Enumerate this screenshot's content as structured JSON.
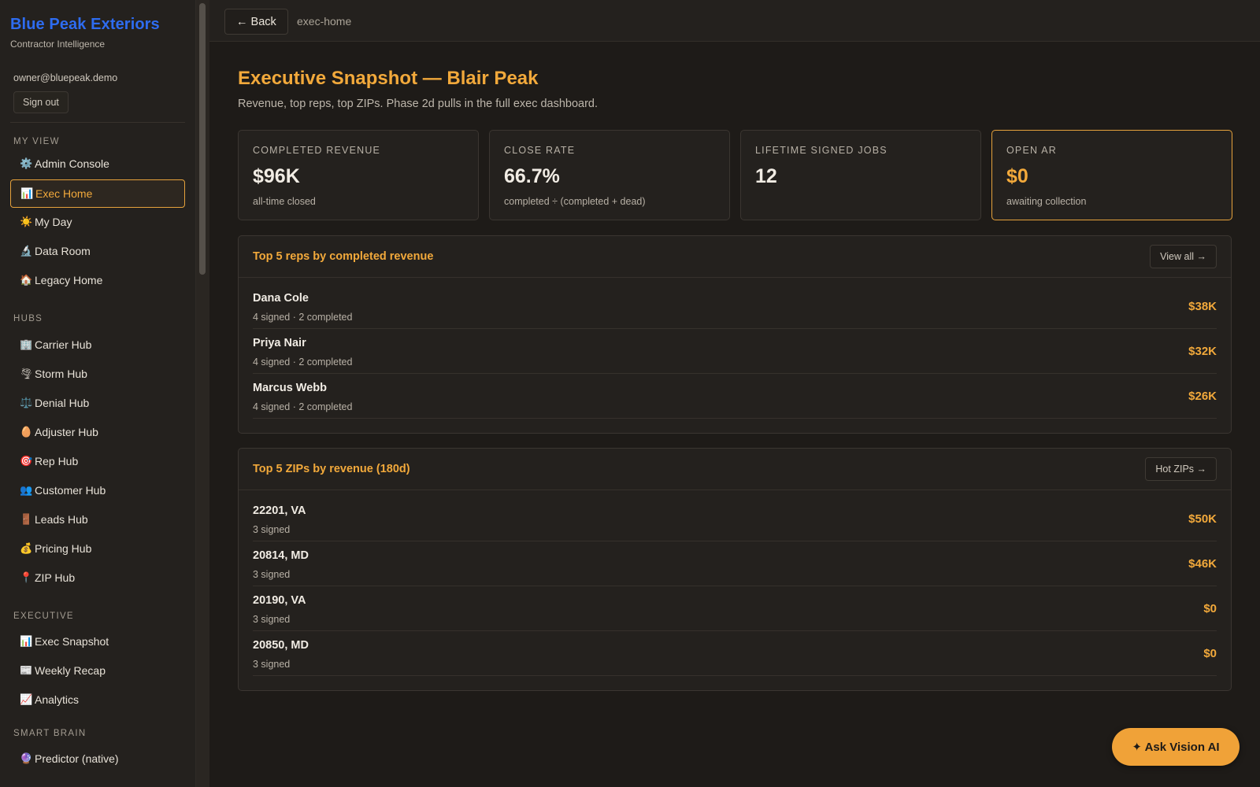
{
  "brand": {
    "title": "Blue Peak Exteriors",
    "subtitle": "Contractor Intelligence"
  },
  "account": {
    "email": "owner@bluepeak.demo",
    "signout_label": "Sign out"
  },
  "sections": {
    "my_view": "MY VIEW",
    "hubs": "HUBS",
    "executive": "EXECUTIVE",
    "smart_brain": "SMART BRAIN"
  },
  "nav": {
    "my_view": [
      {
        "icon": "⚙️",
        "label": "Admin Console"
      },
      {
        "icon": "📊",
        "label": "Exec Home",
        "active": true
      },
      {
        "icon": "☀️",
        "label": "My Day"
      },
      {
        "icon": "🔬",
        "label": "Data Room"
      },
      {
        "icon": "🏠",
        "label": "Legacy Home"
      }
    ],
    "hubs": [
      {
        "icon": "🏢",
        "label": "Carrier Hub"
      },
      {
        "icon": "🌪",
        "label": "Storm Hub"
      },
      {
        "icon": "⚖️",
        "label": "Denial Hub"
      },
      {
        "icon": "🥚",
        "label": "Adjuster Hub"
      },
      {
        "icon": "🎯",
        "label": "Rep Hub"
      },
      {
        "icon": "👥",
        "label": "Customer Hub"
      },
      {
        "icon": "🚪",
        "label": "Leads Hub"
      },
      {
        "icon": "💰",
        "label": "Pricing Hub"
      },
      {
        "icon": "📍",
        "label": "ZIP Hub"
      }
    ],
    "executive": [
      {
        "icon": "📊",
        "label": "Exec Snapshot"
      },
      {
        "icon": "📰",
        "label": "Weekly Recap"
      },
      {
        "icon": "📈",
        "label": "Analytics"
      }
    ],
    "smart_brain": [
      {
        "icon": "🔮",
        "label": "Predictor (native)"
      }
    ]
  },
  "topbar": {
    "back_label": "← Back",
    "breadcrumb": "exec-home"
  },
  "page": {
    "title": "Executive Snapshot — Blair Peak",
    "subtitle": "Revenue, top reps, top ZIPs. Phase 2d pulls in the full exec dashboard."
  },
  "kpis": [
    {
      "label": "COMPLETED REVENUE",
      "value": "$96K",
      "note": "all-time closed"
    },
    {
      "label": "CLOSE RATE",
      "value": "66.7%",
      "note": "completed ÷ (completed + dead)"
    },
    {
      "label": "LIFETIME SIGNED JOBS",
      "value": "12",
      "note": ""
    },
    {
      "label": "OPEN AR",
      "value": "$0",
      "note": "awaiting collection"
    }
  ],
  "reps_panel": {
    "title": "Top 5 reps by completed revenue",
    "button": "View all →",
    "rows": [
      {
        "name": "Dana Cole",
        "meta": "4 signed · 2 completed",
        "value": "$38K"
      },
      {
        "name": "Priya Nair",
        "meta": "4 signed · 2 completed",
        "value": "$32K"
      },
      {
        "name": "Marcus Webb",
        "meta": "4 signed · 2 completed",
        "value": "$26K"
      }
    ]
  },
  "zips_panel": {
    "title": "Top 5 ZIPs by revenue (180d)",
    "button": "Hot ZIPs →",
    "rows": [
      {
        "name": "22201, VA",
        "meta": "3 signed",
        "value": "$50K"
      },
      {
        "name": "20814, MD",
        "meta": "3 signed",
        "value": "$46K"
      },
      {
        "name": "20190, VA",
        "meta": "3 signed",
        "value": "$0"
      },
      {
        "name": "20850, MD",
        "meta": "3 signed",
        "value": "$0"
      }
    ]
  },
  "ask_ai": {
    "label": "✦ Ask Vision AI"
  },
  "colors": {
    "accent": "#f2a93b",
    "brand": "#2e6cf0",
    "background": "#1e1b18",
    "panel": "#24211e"
  }
}
